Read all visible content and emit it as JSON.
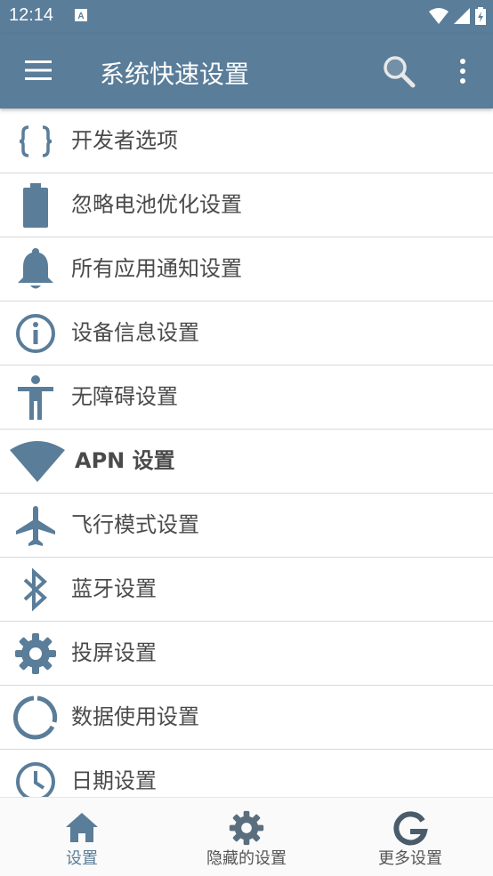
{
  "status_bar": {
    "time": "12:14"
  },
  "app_bar": {
    "title": "系统快速设置",
    "menu_icon": "hamburger-menu-icon",
    "search_icon": "search-icon",
    "more_icon": "more-vert-icon"
  },
  "colors": {
    "primary": "#5a7d99",
    "icon": "#5a7d99",
    "text": "#4a4a4a",
    "divider": "#d9d9d9"
  },
  "list": {
    "items": [
      {
        "icon": "braces-icon",
        "label": "开发者选项"
      },
      {
        "icon": "battery-icon",
        "label": "忽略电池优化设置"
      },
      {
        "icon": "bell-icon",
        "label": "所有应用通知设置"
      },
      {
        "icon": "info-icon",
        "label": "设备信息设置"
      },
      {
        "icon": "accessibility-icon",
        "label": "无障碍设置"
      },
      {
        "icon": "wifi-icon",
        "label": "APN 设置"
      },
      {
        "icon": "airplane-icon",
        "label": "飞行模式设置"
      },
      {
        "icon": "bluetooth-icon",
        "label": "蓝牙设置"
      },
      {
        "icon": "gear-icon",
        "label": "投屏设置"
      },
      {
        "icon": "data-usage-icon",
        "label": "数据使用设置"
      },
      {
        "icon": "clock-icon",
        "label": "日期设置"
      }
    ]
  },
  "bottom_nav": {
    "items": [
      {
        "icon": "home-icon",
        "label": "设置",
        "active": true
      },
      {
        "icon": "gear-icon",
        "label": "隐藏的设置",
        "active": false
      },
      {
        "icon": "google-g-icon",
        "label": "更多设置",
        "active": false
      }
    ]
  }
}
